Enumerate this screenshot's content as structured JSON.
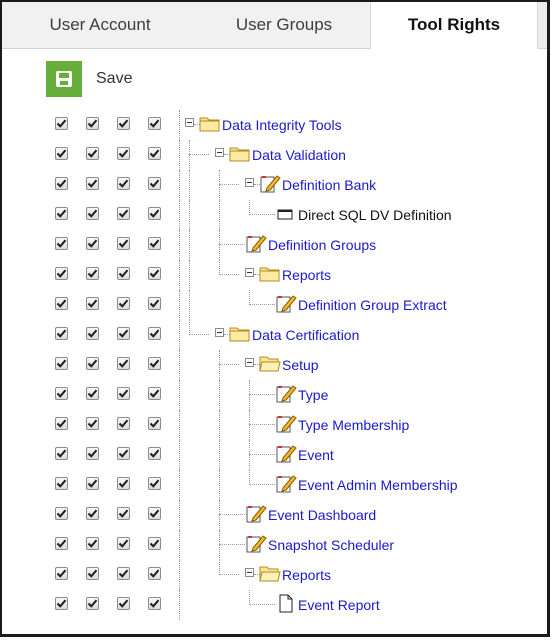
{
  "tabs": [
    {
      "label": "User Account",
      "active": false
    },
    {
      "label": "User Groups",
      "active": false
    },
    {
      "label": "Tool Rights",
      "active": true
    }
  ],
  "toolbar": {
    "save_label": "Save",
    "save_color": "#67ad3a"
  },
  "link_color": "#1a1acc",
  "tree": [
    {
      "label": "Data Integrity Tools",
      "level": 0,
      "icon": "folder-icon",
      "expander": "collapse-toggle",
      "checks": [
        true,
        true,
        true,
        true
      ]
    },
    {
      "label": "Data Validation",
      "level": 1,
      "icon": "folder-icon",
      "expander": "collapse-toggle",
      "checks": [
        true,
        true,
        true,
        true
      ]
    },
    {
      "label": "Definition Bank",
      "level": 2,
      "icon": "edit-icon",
      "expander": "collapse-toggle",
      "checks": [
        true,
        true,
        true,
        true
      ]
    },
    {
      "label": "Direct SQL DV Definition",
      "level": 3,
      "icon": "window-icon",
      "expander": "",
      "checks": [
        true,
        true,
        true,
        true
      ]
    },
    {
      "label": "Definition Groups",
      "level": 2,
      "icon": "edit-icon",
      "expander": "",
      "checks": [
        true,
        true,
        true,
        true
      ]
    },
    {
      "label": "Reports",
      "level": 2,
      "icon": "folder-icon",
      "expander": "collapse-toggle",
      "checks": [
        true,
        true,
        true,
        true
      ]
    },
    {
      "label": "Definition Group Extract",
      "level": 3,
      "icon": "edit-icon",
      "expander": "",
      "checks": [
        true,
        true,
        true,
        true
      ]
    },
    {
      "label": "Data Certification",
      "level": 1,
      "icon": "folder-icon",
      "expander": "collapse-toggle",
      "checks": [
        true,
        true,
        true,
        true
      ]
    },
    {
      "label": "Setup",
      "level": 2,
      "icon": "open-folder-icon",
      "expander": "collapse-toggle",
      "checks": [
        true,
        true,
        true,
        true
      ]
    },
    {
      "label": "Type",
      "level": 3,
      "icon": "edit-icon",
      "expander": "",
      "checks": [
        true,
        true,
        true,
        true
      ]
    },
    {
      "label": "Type Membership",
      "level": 3,
      "icon": "edit-icon",
      "expander": "",
      "checks": [
        true,
        true,
        true,
        true
      ]
    },
    {
      "label": "Event",
      "level": 3,
      "icon": "edit-icon",
      "expander": "",
      "checks": [
        true,
        true,
        true,
        true
      ]
    },
    {
      "label": "Event Admin Membership",
      "level": 3,
      "icon": "edit-icon",
      "expander": "",
      "checks": [
        true,
        true,
        true,
        true
      ]
    },
    {
      "label": "Event Dashboard",
      "level": 2,
      "icon": "edit-icon",
      "expander": "",
      "checks": [
        true,
        true,
        true,
        true
      ]
    },
    {
      "label": "Snapshot Scheduler",
      "level": 2,
      "icon": "edit-icon",
      "expander": "",
      "checks": [
        true,
        true,
        true,
        true
      ]
    },
    {
      "label": "Reports",
      "level": 2,
      "icon": "open-folder-icon",
      "expander": "collapse-toggle",
      "checks": [
        true,
        true,
        true,
        true
      ]
    },
    {
      "label": "Event Report",
      "level": 3,
      "icon": "document-icon",
      "expander": "",
      "checks": [
        true,
        true,
        true,
        true
      ]
    }
  ]
}
